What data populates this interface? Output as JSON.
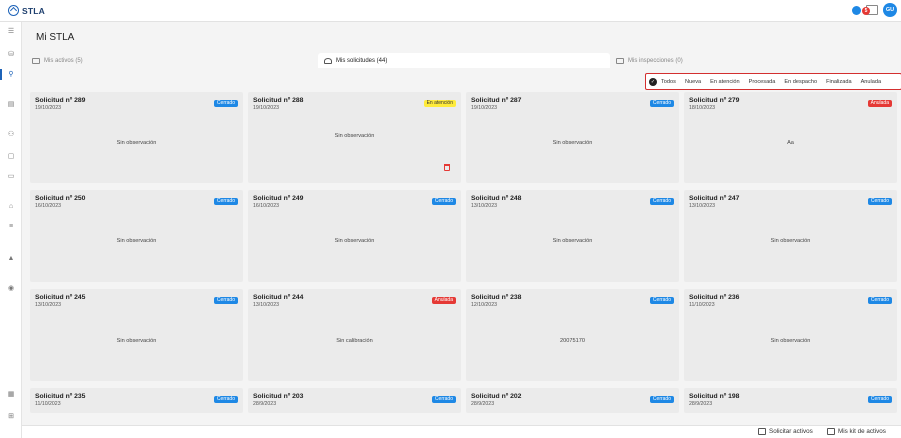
{
  "app": {
    "brand": "STLA",
    "notification_count": "5",
    "user_initials": "GU"
  },
  "page": {
    "title": "Mi STLA"
  },
  "tabs": [
    {
      "label": "Mis activos (5)"
    },
    {
      "label": "Mis solicitudes (44)"
    },
    {
      "label": "Mis inspecciones (0)"
    }
  ],
  "filters": [
    "Todos",
    "Nueva",
    "En atención",
    "Procesada",
    "En despacho",
    "Finalizada",
    "Anulada"
  ],
  "cards": [
    {
      "title": "Solicitud nº 289",
      "date": "19/10/2023",
      "status": "Cerrado",
      "status_type": "cerrado",
      "obs": "Sin observación"
    },
    {
      "title": "Solicitud nº 288",
      "date": "19/10/2023",
      "status": "En atención",
      "status_type": "atencion",
      "obs": "Sin observación"
    },
    {
      "title": "Solicitud nº 287",
      "date": "19/10/2023",
      "status": "Cerrado",
      "status_type": "cerrado",
      "obs": "Sin observación"
    },
    {
      "title": "Solicitud nº 279",
      "date": "18/10/2023",
      "status": "Anulada",
      "status_type": "anulada",
      "obs": "Aa"
    },
    {
      "title": "Solicitud nº 250",
      "date": "16/10/2023",
      "status": "Cerrado",
      "status_type": "cerrado",
      "obs": "Sin observación"
    },
    {
      "title": "Solicitud nº 249",
      "date": "16/10/2023",
      "status": "Cerrado",
      "status_type": "cerrado",
      "obs": "Sin observación"
    },
    {
      "title": "Solicitud nº 248",
      "date": "13/10/2023",
      "status": "Cerrado",
      "status_type": "cerrado",
      "obs": "Sin observación"
    },
    {
      "title": "Solicitud nº 247",
      "date": "13/10/2023",
      "status": "Cerrado",
      "status_type": "cerrado",
      "obs": "Sin observación"
    },
    {
      "title": "Solicitud nº 245",
      "date": "13/10/2023",
      "status": "Cerrado",
      "status_type": "cerrado",
      "obs": "Sin observación"
    },
    {
      "title": "Solicitud nº 244",
      "date": "13/10/2023",
      "status": "Anulada",
      "status_type": "anulada",
      "obs": "Sin calibración"
    },
    {
      "title": "Solicitud nº 238",
      "date": "12/10/2023",
      "status": "Cerrado",
      "status_type": "cerrado",
      "obs": "20075170"
    },
    {
      "title": "Solicitud nº 236",
      "date": "11/10/2023",
      "status": "Cerrado",
      "status_type": "cerrado",
      "obs": "Sin observación"
    },
    {
      "title": "Solicitud nº 235",
      "date": "11/10/2023",
      "status": "Cerrado",
      "status_type": "cerrado",
      "obs": ""
    },
    {
      "title": "Solicitud nº 203",
      "date": "28/9/2023",
      "status": "Cerrado",
      "status_type": "cerrado",
      "obs": ""
    },
    {
      "title": "Solicitud nº 202",
      "date": "28/9/2023",
      "status": "Cerrado",
      "status_type": "cerrado",
      "obs": ""
    },
    {
      "title": "Solicitud nº 198",
      "date": "28/9/2023",
      "status": "Cerrado",
      "status_type": "cerrado",
      "obs": ""
    }
  ],
  "footer": {
    "request_assets": "Solicitar activos",
    "my_kit": "Mis kit de activos"
  },
  "colors": {
    "primary": "#1e88e5",
    "danger": "#e53935",
    "warning": "#ffeb3b",
    "filter_border": "#d32f2f"
  }
}
